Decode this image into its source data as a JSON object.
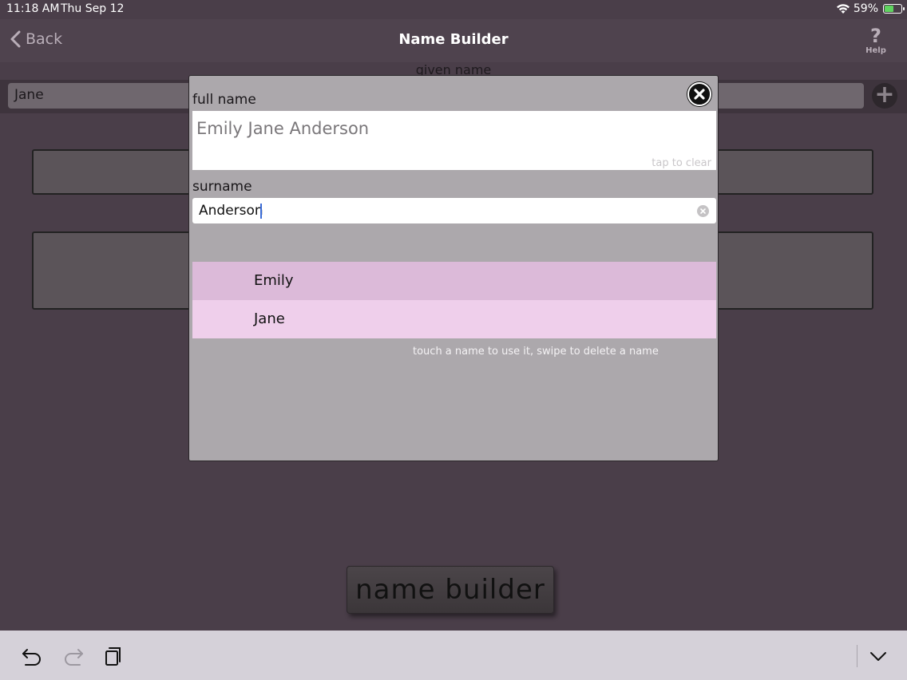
{
  "status_bar": {
    "time": "11:18 AM",
    "date": "Thu Sep 12",
    "battery_percent": "59%",
    "battery_level": 0.59,
    "icons": [
      "wifi-icon",
      "battery-icon"
    ]
  },
  "nav": {
    "back_label": "Back",
    "title": "Name Builder",
    "help_label": "Help",
    "help_mark": "?"
  },
  "background": {
    "given_name_label": "given name",
    "given_name_value": "Jane",
    "add_symbol": "+",
    "name_builder_button": "name builder"
  },
  "modal": {
    "full_name_label": "full name",
    "full_name_value": "Emily Jane Anderson",
    "tap_to_clear": "tap to clear",
    "surname_label": "surname",
    "surname_value": "Anderson",
    "names": [
      "Emily",
      "Jane"
    ],
    "hint": "touch a name to use it, swipe to delete a name"
  },
  "colors": {
    "row_emily": "#dcbad9",
    "row_jane": "#efcfeb",
    "modal_bg": "#aca8ac",
    "background": "#4a3e49"
  }
}
